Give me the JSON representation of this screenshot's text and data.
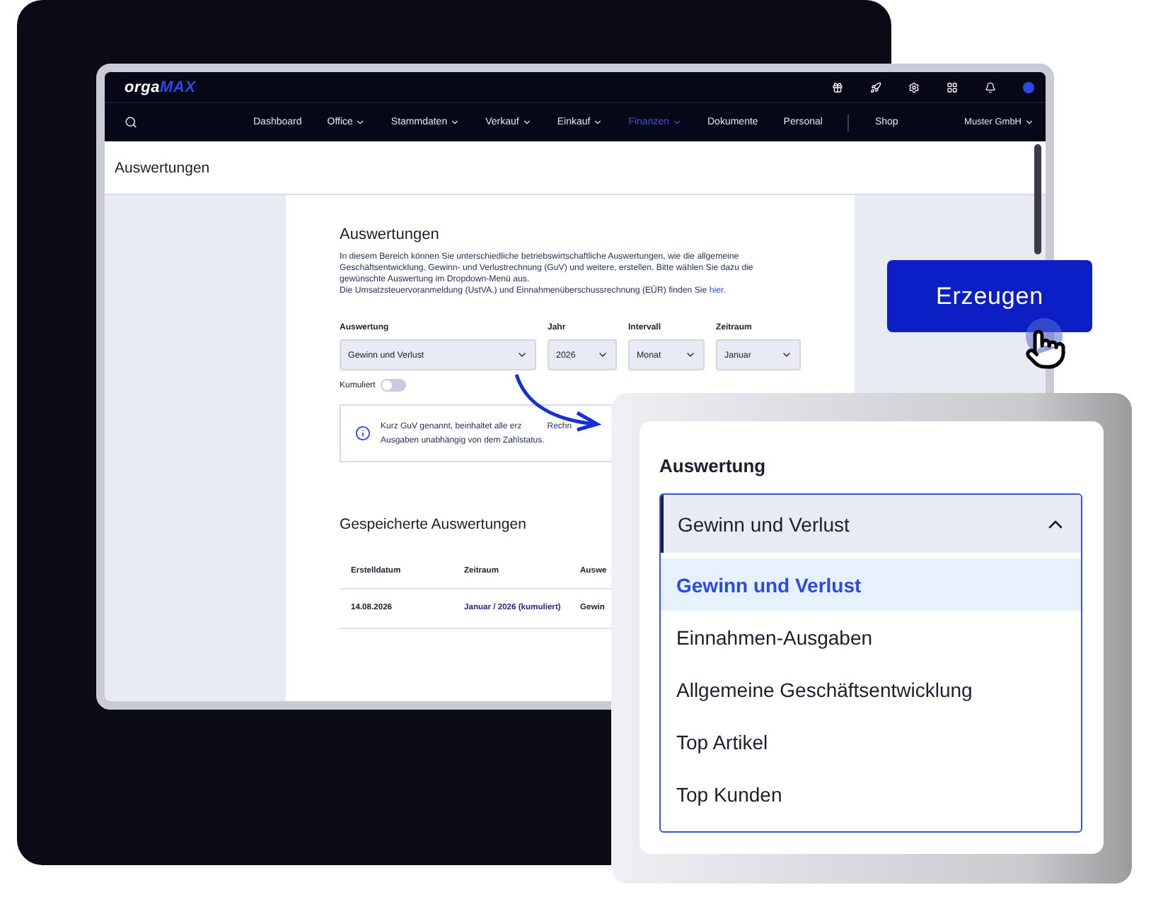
{
  "app": {
    "logo": {
      "first": "orga",
      "second": "MAX"
    },
    "nav": [
      {
        "label": "Dashboard",
        "has_menu": false,
        "selected": false
      },
      {
        "label": "Office",
        "has_menu": true,
        "selected": false
      },
      {
        "label": "Stammdaten",
        "has_menu": true,
        "selected": false
      },
      {
        "label": "Verkauf",
        "has_menu": true,
        "selected": false
      },
      {
        "label": "Einkauf",
        "has_menu": true,
        "selected": false
      },
      {
        "label": "Finanzen",
        "has_menu": true,
        "selected": true
      },
      {
        "label": "Dokumente",
        "has_menu": false,
        "selected": false
      },
      {
        "label": "Personal",
        "has_menu": false,
        "selected": false
      },
      {
        "label": "Shop",
        "has_menu": false,
        "selected": false
      }
    ],
    "company": "Muster GmbH",
    "page_title": "Auswertungen",
    "section_title": "Auswertungen",
    "intro": "In diesem Bereich können Sie unterschiedliche betriebswirtschaftliche Auswertungen, wie die allgemeine Geschäftsentwicklung, Gewinn- und Verlustrechnung (GuV) und weitere, erstellen. Bitte wählen Sie dazu die gewünschte Auswertung im Dropdown-Menü aus.",
    "intro_line2": "Die Umsatzsteuervoranmeldung (UstVA.) und Einnahmenüberschussrechnung (EÜR) finden Sie",
    "intro_link": "hier.",
    "filters": [
      {
        "label": "Auswertung",
        "value": "Gewinn und Verlust"
      },
      {
        "label": "Jahr",
        "value": "2026"
      },
      {
        "label": "Intervall",
        "value": "Monat"
      },
      {
        "label": "Zeitraum",
        "value": "Januar"
      }
    ],
    "cumulative": {
      "label": "Kumuliert",
      "on": false
    },
    "info": {
      "line1": "Kurz GuV genannt, beinhaltet alle erz",
      "line1_rest": "Rechn",
      "line2": "Ausgaben unabhängig von dem Zahlstatus."
    },
    "saved_title": "Gespeicherte Auswertungen",
    "table": {
      "columns": [
        "Erstelldatum",
        "Zeitraum",
        "Auswe"
      ],
      "rows": [
        [
          "14.08.2026",
          "Januar / 2026 (kumuliert)",
          "Gewin"
        ]
      ]
    }
  },
  "generate_button": "Erzeugen",
  "dropdown": {
    "label": "Auswertung",
    "value": "Gewinn und Verlust",
    "expanded": true,
    "options": [
      {
        "label": "Gewinn und Verlust",
        "selected": true
      },
      {
        "label": "Einnahmen-Ausgaben",
        "selected": false
      },
      {
        "label": "Allgemeine Geschäftsentwicklung",
        "selected": false
      },
      {
        "label": "Top Artikel",
        "selected": false
      },
      {
        "label": "Top Kunden",
        "selected": false
      }
    ]
  }
}
